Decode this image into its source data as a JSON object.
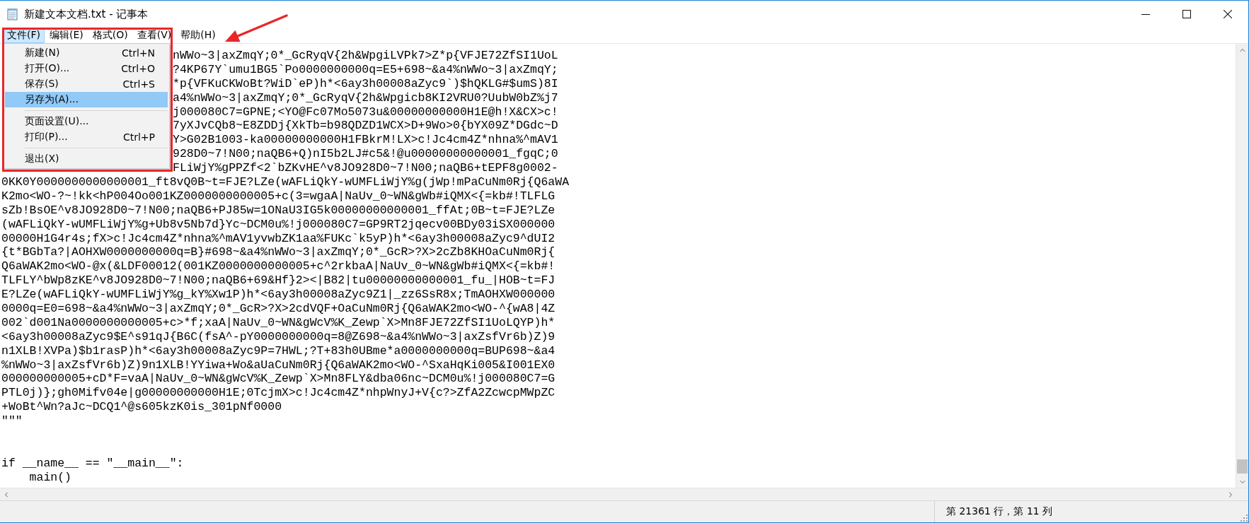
{
  "window": {
    "title": "新建文本文档.txt - 记事本"
  },
  "menubar": {
    "items": [
      {
        "label": "文件(F)",
        "selected": true
      },
      {
        "label": "编辑(E)",
        "selected": false
      },
      {
        "label": "格式(O)",
        "selected": false
      },
      {
        "label": "查看(V)",
        "selected": false
      },
      {
        "label": "帮助(H)",
        "selected": false
      }
    ]
  },
  "file_menu": {
    "items": [
      {
        "kind": "item",
        "label": "新建(N)",
        "shortcut": "Ctrl+N",
        "selected": false
      },
      {
        "kind": "item",
        "label": "打开(O)...",
        "shortcut": "Ctrl+O",
        "selected": false
      },
      {
        "kind": "item",
        "label": "保存(S)",
        "shortcut": "Ctrl+S",
        "selected": false
      },
      {
        "kind": "item",
        "label": "另存为(A)...",
        "selected": true
      },
      {
        "kind": "separator"
      },
      {
        "kind": "item",
        "label": "页面设置(U)...",
        "selected": false
      },
      {
        "kind": "item",
        "label": "打印(P)...",
        "shortcut": "Ctrl+P",
        "selected": false
      },
      {
        "kind": "separator"
      },
      {
        "kind": "item",
        "label": "退出(X)",
        "selected": false
      }
    ]
  },
  "editor": {
    "lines": [
      {
        "kind": "covered",
        "text": "nWWo~3|axZmqY;0*_GcRyqV{2h&WpgiLVPk7>Z*p{VFJE72ZfSI1UoL"
      },
      {
        "kind": "covered",
        "text": "?4KP67Y`umu1BG5`Po0000000000q=E5+698~&a4%nWWo~3|axZmqY;"
      },
      {
        "kind": "covered",
        "text": "*p{VFKuCKWoBt?WiD`eP)h*<6ay3h00008aZyc9`)$hQKLG#$umS)8I"
      },
      {
        "kind": "covered",
        "text": "a4%nWWo~3|axZmqY;0*_GcRyqV{2h&Wpgicb8KI2VRU0?UubW0bZ%j7"
      },
      {
        "kind": "covered",
        "text": "j000080C7=GPNE;<YO@Fc07Mo5073u&00000000000H1E@h!X&CX>c!"
      },
      {
        "kind": "covered",
        "text": "7yXJvCQb8~E8ZDDj{XkTb=b98QDZD1WCX>D+9Wo>0{bYX09Z*DGdc~D"
      },
      {
        "kind": "covered",
        "text": "Y>G02B1003-ka00000000000H1FBkrM!LX>c!Jc4cm4Z*nhna%^mAV1"
      },
      {
        "kind": "covered",
        "text": "928D0~7!N00;naQB6+Q)nI5b2LJ#c5&!@u00000000000001_fgqC;0"
      },
      {
        "kind": "covered",
        "text": "FLiWjY%gPPZf<2`bZKvHE^v8JO928D0~7!N00;naQB6+tEPF8g0002-"
      },
      {
        "kind": "text",
        "text": "0KK0Y0000000000000001_ft8vQ0B~t=FJE?LZe(wAFLiQkY-wUMFLiWjY%g(jWp!mPaCuNm0Rj{Q6aWA"
      },
      {
        "kind": "text",
        "text": "K2mo<WO-?~!kk<hP004Oo001KZ0000000000005+c(3=wgaA|NaUv_0~WN&gWb#iQMX<{=kb#!TLFLG"
      },
      {
        "kind": "text",
        "text": "sZb!BsOE^v8JO928D0~7!N00;naQB6+PJ85w=1ONaU3IG5k00000000000001_ffAt;0B~t=FJE?LZe"
      },
      {
        "kind": "text",
        "text": "(wAFLiQkY-wUMFLiWjY%g+Ub8v5Nb7d}Yc~DCM0u%!j000080C7=GP9RT2jqecv00BDy03iSX000000"
      },
      {
        "kind": "text",
        "text": "00000H1G4r4s;fX>c!Jc4cm4Z*nhna%^mAV1yvwbZK1aa%FUKc`k5yP)h*<6ay3h00008aZyc9^dUI2"
      },
      {
        "kind": "text",
        "text": "{t*BGbTa?|AOHXW0000000000q=B}#698~&a4%nWWo~3|axZmqY;0*_GcR>?X>2cZb8KHOaCuNm0Rj{"
      },
      {
        "kind": "text",
        "text": "Q6aWAK2mo<WO-@x(&LDF00012(001KZ0000000000005+c^2rkbaA|NaUv_0~WN&gWb#iQMX<{=kb#!"
      },
      {
        "kind": "text",
        "text": "TLFLY^bWp8zKE^v8JO928D0~7!N00;naQB6+69&Hf}2><|B82|tu00000000000001_fu_|HOB~t=FJ"
      },
      {
        "kind": "text",
        "text": "E?LZe(wAFLiQkY-wUMFLiWjY%g_kY%Xw1P)h*<6ay3h00008aZyc9Z1|_zz6SsR8x;TmAOHXW000000"
      },
      {
        "kind": "text",
        "text": "0000q=E0=698~&a4%nWWo~3|axZmqY;0*_GcR>?X>2cdVQF+OaCuNm0Rj{Q6aWAK2mo<WO-^{wA8|4Z"
      },
      {
        "kind": "text",
        "text": "002`d001Na0000000000005+c>*f;xaA|NaUv_0~WN&gWcV%K_Zewp`X>Mn8FJE72ZfSI1UoLQYP)h*"
      },
      {
        "kind": "text",
        "text": "<6ay3h00008aZyc9$E^s91qJ{B6C(fsA^-pY0000000000q=8@Z698~&a4%nWWo~3|axZsfVr6b)Z)9"
      },
      {
        "kind": "text",
        "text": "n1XLB!XVPa)$b1rasP)h*<6ay3h00008aZyc9P=7HWL;?T+83h0UBme*a0000000000q=BUP698~&a4"
      },
      {
        "kind": "text",
        "text": "%nWWo~3|axZsfVr6b)Z)9n1XLB!YYiwa+Wo&aUaCuNm0Rj{Q6aWAK2mo<WO-^SxaHqKi005&I001EX0"
      },
      {
        "kind": "text",
        "text": "000000000005+cD*F=vaA|NaUv_0~WN&gWcV%K_Zewp`X>Mn8FLY&dba06nc~DCM0u%!j000080C7=G"
      },
      {
        "kind": "text",
        "text": "PTL0j)};gh0Mifv04e|g00000000000H1E;0TcjmX>c!Jc4cm4Z*nhpWnyJ+V{c?>ZfA2ZcwcpMWpZC"
      },
      {
        "kind": "text",
        "text": "+WoBt^Wn?aJc~DCQ1^@s605kzK0is_301pNf0000"
      },
      {
        "kind": "text",
        "text": "\"\"\""
      },
      {
        "kind": "blank"
      },
      {
        "kind": "blank"
      },
      {
        "kind": "text",
        "text": "if __name__ == \"__main__\":"
      },
      {
        "kind": "text",
        "text": "    main()"
      }
    ]
  },
  "status_bar": {
    "position": "第 21361 行，第 11 列"
  }
}
